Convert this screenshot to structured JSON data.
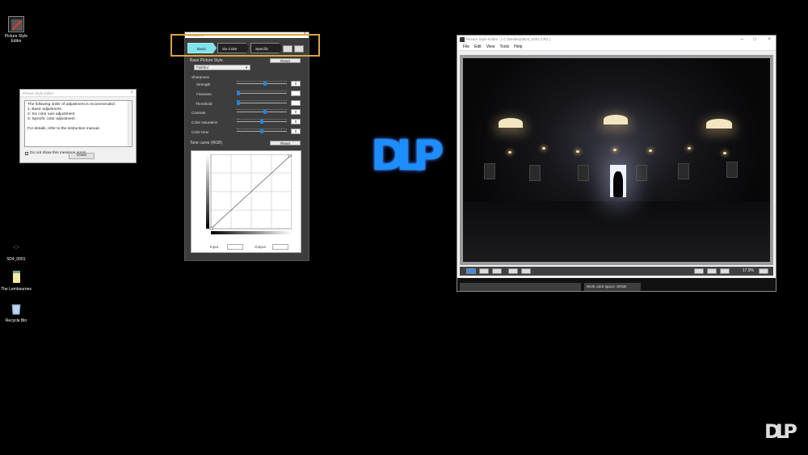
{
  "desktop": {
    "icons": [
      {
        "label": "Picture Style Editor"
      },
      {
        "label": "5D4_0001"
      },
      {
        "label": "The Lembournes"
      },
      {
        "label": "Recycle Bin"
      }
    ]
  },
  "message_dialog": {
    "title": "Picture Style Editor",
    "lines": [
      "The following order of adjustment is recommended:",
      "1: Basic adjustment",
      "2: Six color axis adjustment",
      "3: Specific color adjustment",
      "",
      "For details, refer to the instruction manual."
    ],
    "checkbox_label": "Do not show this message again.",
    "close_label": "Close"
  },
  "palette": {
    "title": "Tool palette",
    "tabs": [
      {
        "label": "Basic",
        "active": true
      },
      {
        "label": "Six Color Axes",
        "active": false
      },
      {
        "label": "Specific Colors",
        "active": false
      }
    ],
    "base_title": "Base Picture Style",
    "reset_label": "Reset",
    "base_value": "Faithful",
    "sharpness_label": "Sharpness",
    "params": [
      {
        "label": "Strength",
        "value": "0",
        "level": 0.57
      },
      {
        "label": "Fineness",
        "value": "",
        "level": 0.0
      },
      {
        "label": "Threshold",
        "value": "",
        "level": 0.0
      },
      {
        "label": "Contrast",
        "value": "0",
        "level": 0.57
      },
      {
        "label": "Color saturation",
        "value": "0",
        "level": 0.5
      },
      {
        "label": "Color tone",
        "value": "0",
        "level": 0.5
      }
    ],
    "tone_curve_title": "Tone curve (RGB)",
    "tone_reset_label": "Reset",
    "input_label": "Input",
    "output_label": "Output",
    "highlight_color": "#d9a441",
    "active_tab_color": "#7fe3ec",
    "slider_color": "#1e86e6"
  },
  "logo": {
    "text": "DLP",
    "color": "#1b8fff"
  },
  "watermark": {
    "text": "DLP"
  },
  "editor": {
    "title": "Picture Style Editor - [ C:\\Desktop\\5D4_0001.CR2 ]",
    "menu": [
      "File",
      "Edit",
      "View",
      "Tools",
      "Help"
    ],
    "zoom": "17.9%",
    "status_text": "Work color space: sRGB"
  }
}
